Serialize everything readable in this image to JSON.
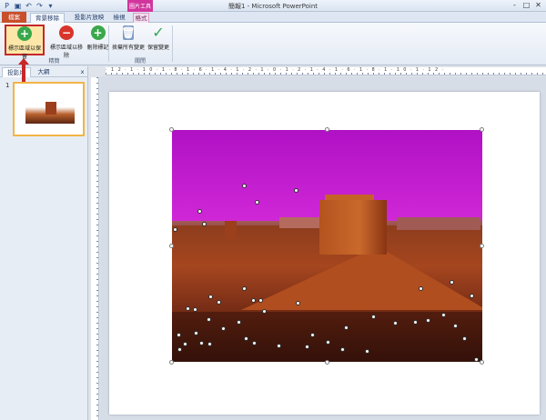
{
  "titlebar": {
    "title": "簡報1 - Microsoft PowerPoint",
    "context_tab": "圖片工具",
    "qat_icons": [
      "save-icon",
      "undo-icon",
      "redo-icon",
      "customize-icon"
    ],
    "window_buttons": [
      "-",
      "□",
      "✕"
    ]
  },
  "tabs": {
    "file": "檔案",
    "background_removal": "背景移除",
    "slideshow": "投影片放映",
    "view": "檢視",
    "format": "格式"
  },
  "ribbon": {
    "mark_keep": "標示區域以保留",
    "mark_remove": "標示區域以移除",
    "delete_mark": "刪除標記",
    "discard_all": "捨棄所有變更",
    "keep_changes": "保留變更",
    "group_refine": "精簡",
    "group_close": "關閉"
  },
  "leftpanel": {
    "tab_slides": "投影片",
    "tab_outline": "大綱",
    "close": "x",
    "slide_number": "1"
  },
  "ruler": {
    "h_numbers": "·12·1·10·1·8·1·6·1·4·1·2·1·0·1·2·1·4·1·6·1·8·1·10·1·12·"
  },
  "colors": {
    "file_tab": "#c94f2b",
    "context_tab": "#d1359d",
    "removal_overlay": "#c41bd2",
    "highlight_border": "#c62828",
    "selected_button": "#fde7a8"
  }
}
